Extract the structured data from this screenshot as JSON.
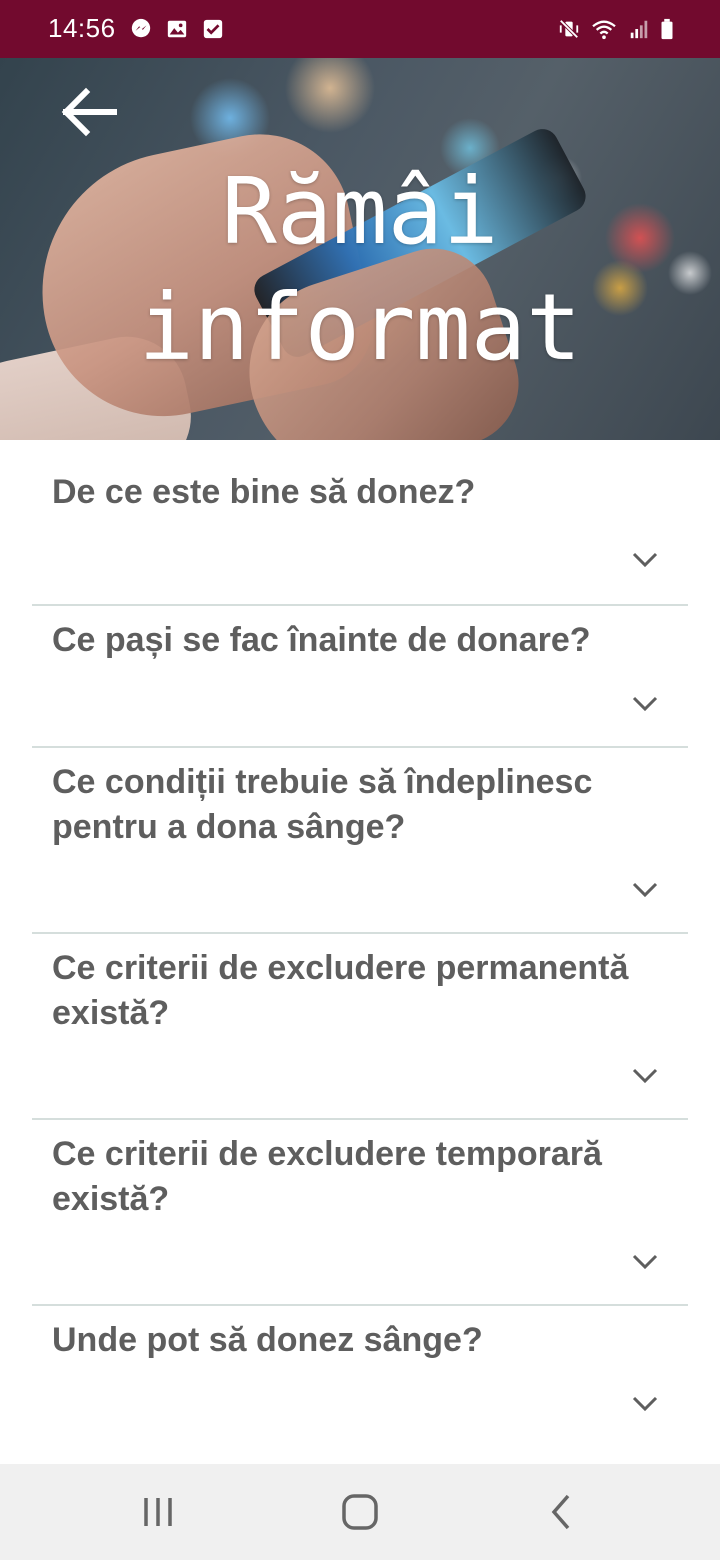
{
  "status_bar": {
    "time": "14:56",
    "background": "#720a2e",
    "left_icons": [
      "messenger-icon",
      "image-icon",
      "checkbox-icon"
    ],
    "right_icons": [
      "mute-vibrate-icon",
      "wifi-icon",
      "signal-icon",
      "battery-icon"
    ]
  },
  "header": {
    "title": "Rămâi informat",
    "back_icon": "arrow-left-icon"
  },
  "faq": [
    {
      "question": "De ce este bine să donez?"
    },
    {
      "question": "Ce pași se fac înainte de donare?"
    },
    {
      "question": "Ce condiții trebuie să îndeplinesc pentru a dona sânge?"
    },
    {
      "question": "Ce criterii de excludere permanentă există?"
    },
    {
      "question": "Ce criterii de excludere temporară există?"
    },
    {
      "question": "Unde pot să donez sânge?"
    }
  ],
  "colors": {
    "question_text": "#5e5e5e",
    "divider": "#d5dedc",
    "nav_background": "#f0f0f0"
  },
  "nav_bar": {
    "icons": [
      "recents-icon",
      "home-icon",
      "back-icon"
    ]
  }
}
